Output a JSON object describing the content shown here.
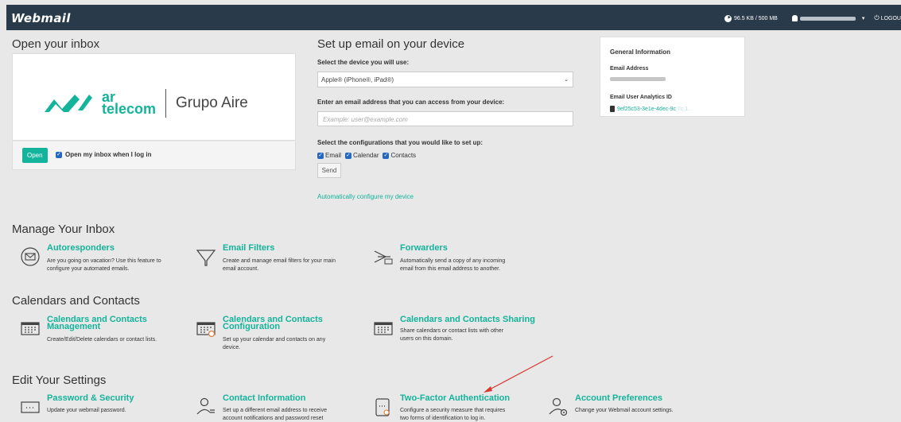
{
  "header": {
    "logo": "Webmail",
    "quota": "96.5 KB / 500 MB",
    "logout": "LOGOU"
  },
  "inbox": {
    "title": "Open your inbox",
    "brand_line1": "ar",
    "brand_line2": "telecom",
    "brand_group": "Grupo Aire",
    "open_label": "Open",
    "open_on_login_label": "Open my inbox when I log in",
    "open_on_login_checked": true
  },
  "setup": {
    "title": "Set up email on your device",
    "device_label": "Select the device you will use:",
    "device_value": "Apple® (iPhone®, iPad®)",
    "email_label": "Enter an email address that you can access from your device:",
    "email_placeholder": "Example: user@example.com",
    "config_label": "Select the configurations that you would like to set up:",
    "configs": [
      {
        "label": "Email",
        "checked": true
      },
      {
        "label": "Calendar",
        "checked": true
      },
      {
        "label": "Contacts",
        "checked": true
      }
    ],
    "send_label": "Send",
    "auto_link": "Automatically configure my device"
  },
  "info": {
    "title": "General Information",
    "email_address_label": "Email Address",
    "analytics_label": "Email User Analytics ID",
    "analytics_value": "9ef25c53-3e1e-4dec-9c",
    "analytics_faded": "7c 1..."
  },
  "manage": {
    "title": "Manage Your Inbox",
    "items": [
      {
        "title": "Autoresponders",
        "desc1": "Are you going on vacation? Use this feature to",
        "desc2": "configure your automated emails.",
        "icon": "autoresponder-icon"
      },
      {
        "title": "Email Filters",
        "desc1": "Create and manage email filters for your main",
        "desc2": "email account.",
        "icon": "filter-icon"
      },
      {
        "title": "Forwarders",
        "desc1": "Automatically send a copy of any incoming",
        "desc2": "email from this email address to another.",
        "icon": "forwarder-icon"
      }
    ]
  },
  "calendars": {
    "title": "Calendars and Contacts",
    "items": [
      {
        "title1": "Calendars and Contacts",
        "title2": "Management",
        "desc1": "Create/Edit/Delete calendars or contact lists.",
        "desc2": "",
        "icon": "calendar-icon"
      },
      {
        "title1": "Calendars and Contacts",
        "title2": "Configuration",
        "desc1": "Set up your calendar and contacts on any",
        "desc2": "device.",
        "icon": "calendar-config-icon"
      },
      {
        "title1": "Calendars and Contacts Sharing",
        "title2": "",
        "desc1": "Share calendars or contact lists with other",
        "desc2": "users on this domain.",
        "icon": "calendar-share-icon"
      }
    ]
  },
  "settings": {
    "title": "Edit Your Settings",
    "items": [
      {
        "title": "Password & Security",
        "desc1": "Update your webmail password.",
        "desc2": "",
        "icon": "password-icon"
      },
      {
        "title": "Contact Information",
        "desc1": "Set up a different email address to receive",
        "desc2": "account notifications and password reset",
        "icon": "contact-info-icon"
      },
      {
        "title": "Two-Factor Authentication",
        "desc1": "Configure a security measure that requires",
        "desc2": "two forms of identification to log in.",
        "icon": "two-factor-icon"
      },
      {
        "title": "Account Preferences",
        "desc1": "Change your Webmail account settings.",
        "desc2": "",
        "icon": "account-preferences-icon"
      }
    ]
  },
  "colors": {
    "accent": "#14b39b",
    "topbar": "#293a4a",
    "checkbox": "#2468c4",
    "annotation_arrow": "#d9382f"
  }
}
